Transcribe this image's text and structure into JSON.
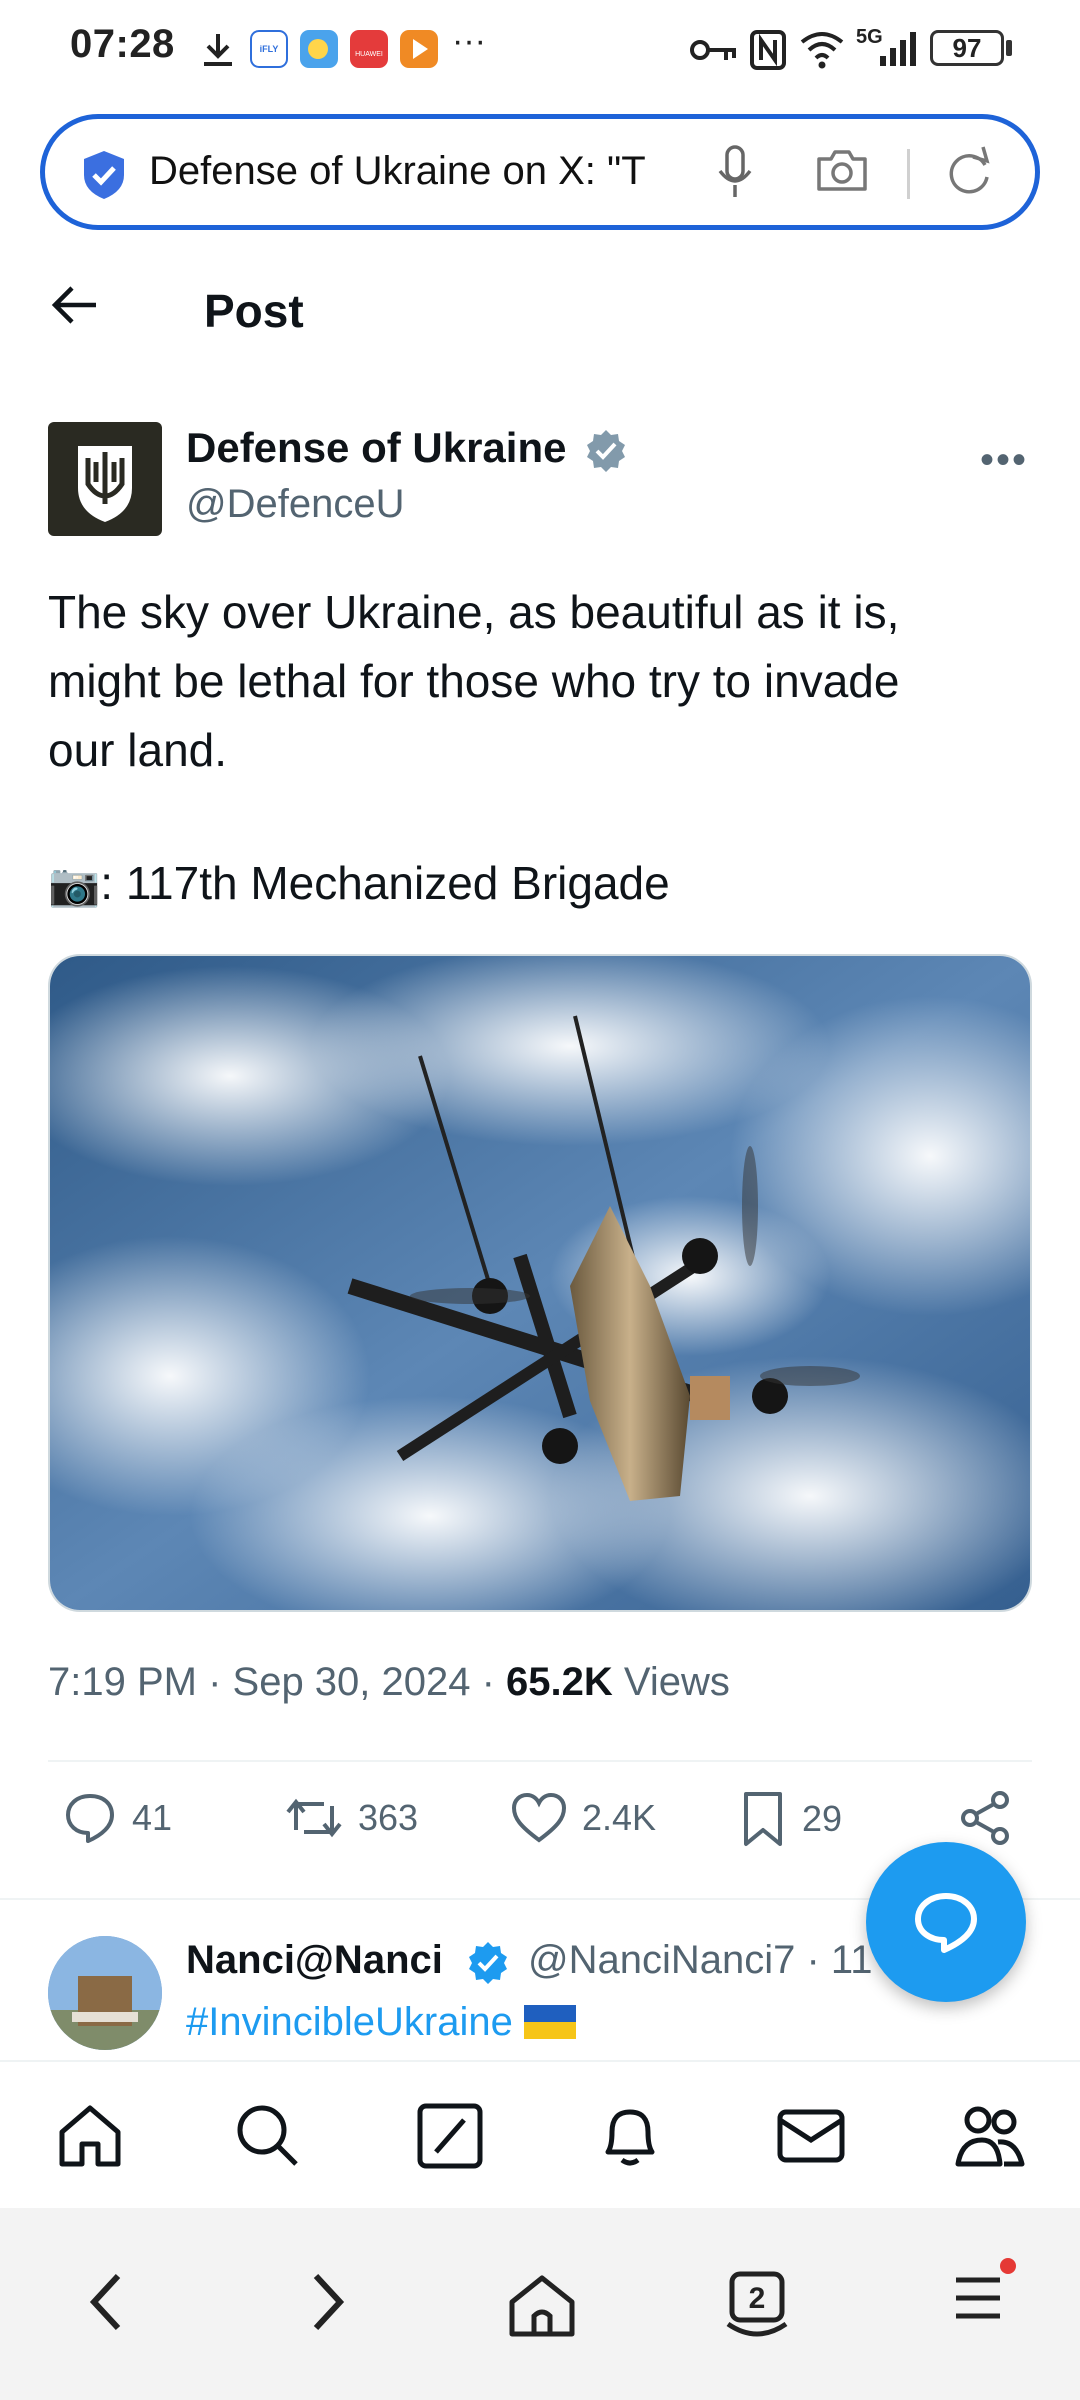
{
  "status_bar": {
    "time": "07:28",
    "battery": "97",
    "network": "5G",
    "icons": [
      "download-icon",
      "ifly-app-icon",
      "weather-app-icon",
      "huawei-app-icon",
      "video-app-icon",
      "more-notifications-icon",
      "key-icon",
      "nfc-icon",
      "wifi-icon",
      "signal-icon",
      "battery-icon"
    ],
    "app_labels": {
      "ifly": "iFLY",
      "huawei": "HUAWEI"
    }
  },
  "address_bar": {
    "text": "Defense of Ukraine on X: \"T"
  },
  "header": {
    "title": "Post"
  },
  "post": {
    "author_name": "Defense of Ukraine",
    "author_handle": "@DefenceU",
    "text": "The sky over Ukraine, as beautiful as it is,\nmight be lethal for those who try to invade\nour land.",
    "photo_credit": ": 117th Mechanized Brigade",
    "timestamp": "7:19 PM · Sep 30, 2024 · ",
    "views_count": "65.2K",
    "views_label": " Views",
    "stats": {
      "replies": "41",
      "reposts": "363",
      "likes": "2.4K",
      "bookmarks": "29"
    }
  },
  "reply": {
    "name": "Nanci@Nanci",
    "handle": "@NanciNanci7 · 11",
    "text": "#InvincibleUkraine "
  },
  "colors": {
    "accent": "#1d9bf0",
    "address_border": "#1e63d8",
    "secondary_text": "#536471",
    "primary_text": "#0f1419"
  }
}
